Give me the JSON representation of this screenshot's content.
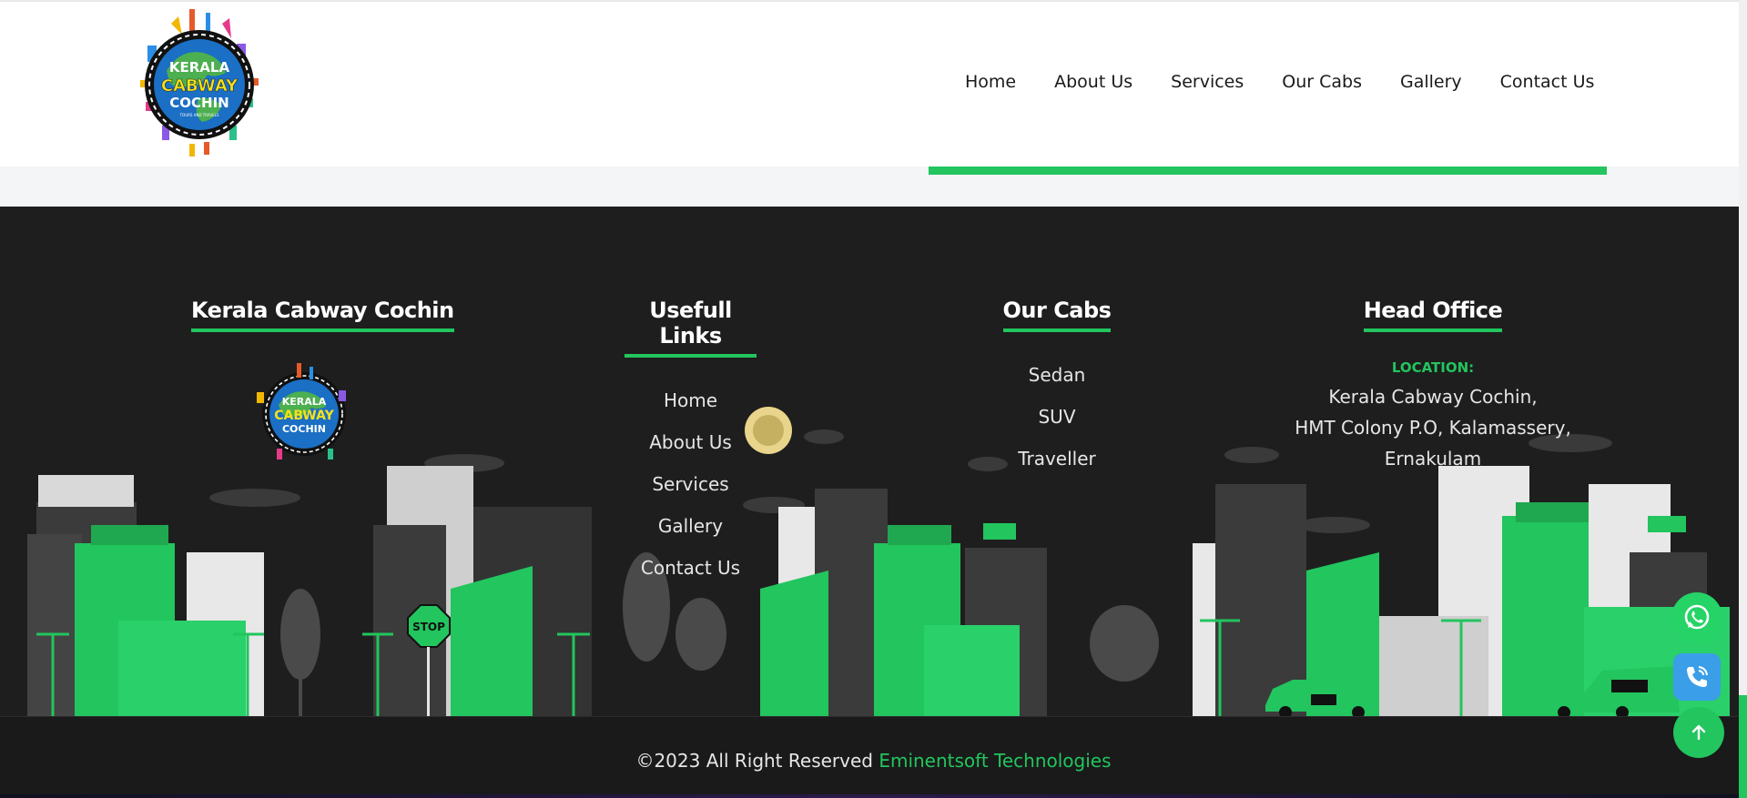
{
  "brand": {
    "logo_line1": "KERALA",
    "logo_line2": "CABWAY",
    "logo_line3": "COCHIN",
    "logo_tagline": "TOURS AND TRAVELS"
  },
  "nav": {
    "items": [
      "Home",
      "About Us",
      "Services",
      "Our Cabs",
      "Gallery",
      "Contact Us"
    ]
  },
  "footer": {
    "about": {
      "title": "Kerala Cabway Cochin"
    },
    "links": {
      "title": "Usefull Links",
      "items": [
        "Home",
        "About Us",
        "Services",
        "Gallery",
        "Contact Us"
      ]
    },
    "cabs": {
      "title": "Our Cabs",
      "items": [
        "Sedan",
        "SUV",
        "Traveller"
      ]
    },
    "office": {
      "title": "Head Office",
      "location_label": "LOCATION:",
      "address_lines": [
        "Kerala Cabway Cochin,",
        "HMT Colony P.O, Kalamassery,",
        "Ernakulam"
      ]
    },
    "copyright": "©2023 All Right Reserved ",
    "copyright_brand": "Eminentsoft Technologies"
  },
  "floating": {
    "whatsapp_icon": "whatsapp-icon",
    "call_icon": "phone-icon",
    "top_icon": "arrow-up-icon"
  },
  "colors": {
    "accent": "#22c55e",
    "footer_bg": "#1e1e1e",
    "header_bg": "#ffffff"
  }
}
